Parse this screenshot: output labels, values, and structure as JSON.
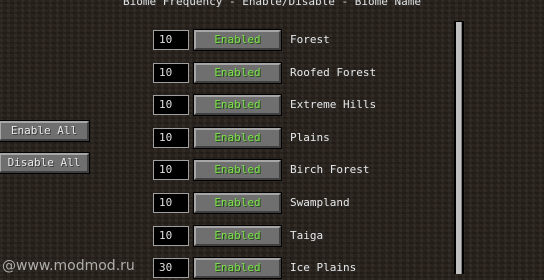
{
  "header": {
    "title": "Biome Frequency - Enable/Disable - Biome Name"
  },
  "sidebar": {
    "enable_all_label": "Enable All",
    "disable_all_label": "Disable All"
  },
  "biomes": [
    {
      "frequency": "10",
      "status": "Enabled",
      "name": "Forest"
    },
    {
      "frequency": "10",
      "status": "Enabled",
      "name": "Roofed Forest"
    },
    {
      "frequency": "10",
      "status": "Enabled",
      "name": "Extreme Hills"
    },
    {
      "frequency": "10",
      "status": "Enabled",
      "name": "Plains"
    },
    {
      "frequency": "10",
      "status": "Enabled",
      "name": "Birch Forest"
    },
    {
      "frequency": "10",
      "status": "Enabled",
      "name": "Swampland"
    },
    {
      "frequency": "10",
      "status": "Enabled",
      "name": "Taiga"
    },
    {
      "frequency": "30",
      "status": "Enabled",
      "name": "Ice Plains"
    }
  ],
  "watermark": {
    "text": "@www.modmod.ru"
  },
  "colors": {
    "enabled_text": "#7ee24a",
    "button_face": "#6f6f6f",
    "background": "#2b241e"
  }
}
